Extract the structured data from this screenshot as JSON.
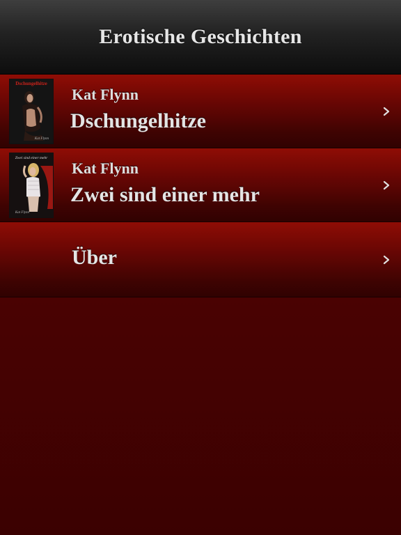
{
  "nav": {
    "title": "Erotische Geschichten"
  },
  "books": [
    {
      "author": "Kat Flynn",
      "title": "Dschungelhitze",
      "cover_title": "Dschungelhitze",
      "cover_signature": "Kat Flynn",
      "cover_icon": "book-cover-image"
    },
    {
      "author": "Kat Flynn",
      "title": "Zwei sind einer mehr",
      "cover_title": "Zwei sind einer mehr",
      "cover_signature": "Kat Flynn",
      "cover_icon": "book-cover-image"
    }
  ],
  "about": {
    "label": "Über"
  },
  "icons": {
    "disclosure": "chevron-right-icon"
  },
  "colors": {
    "accent_red": "#8f0d05",
    "nav_dark": "#1a1a1a",
    "text_light": "#e4e4e4"
  }
}
